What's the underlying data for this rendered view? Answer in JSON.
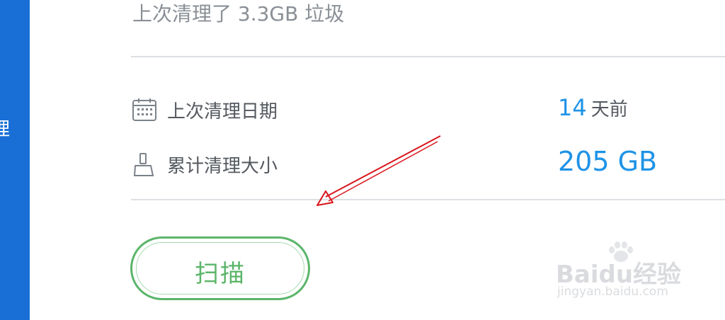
{
  "sidebar": {
    "visible_text": "理"
  },
  "summary": {
    "text": "上次清理了 3.3GB 垃圾"
  },
  "stats": [
    {
      "icon": "calendar-icon",
      "label": "上次清理日期",
      "value": "14",
      "unit": "天前"
    },
    {
      "icon": "broom-icon",
      "label": "累计清理大小",
      "value": "205 GB"
    }
  ],
  "scan_button": {
    "label": "扫描"
  },
  "watermark": {
    "logo": "Baidu经验",
    "url": "jingyan.baidu.com"
  },
  "colors": {
    "sidebar": "#1a6fd6",
    "accent_blue": "#1f93e6",
    "scan_green": "#5bb56a",
    "annotation_red": "#d9141b"
  }
}
